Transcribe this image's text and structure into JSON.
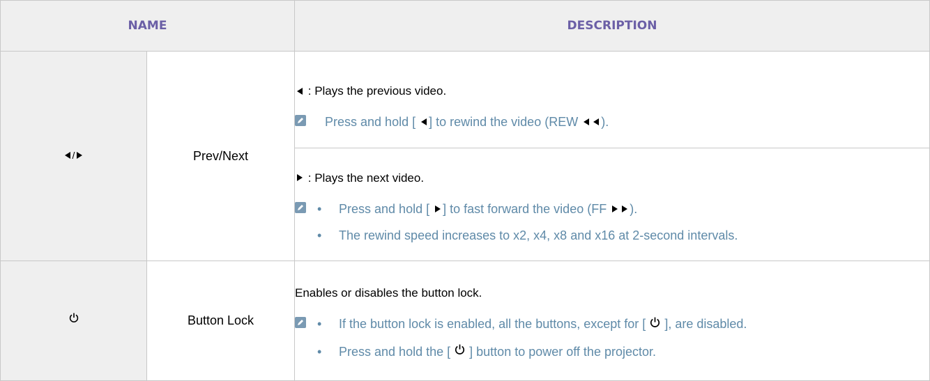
{
  "header": {
    "name": "NAME",
    "description": "DESCRIPTION"
  },
  "rows": {
    "prevnext": {
      "separator": "/",
      "name": "Prev/Next",
      "prev": {
        "lead": ": Plays the previous video.",
        "note_a": "Press and hold [",
        "note_b": "] to rewind the video (REW",
        "note_c": ")."
      },
      "next": {
        "lead": ": Plays the next video.",
        "bullet1_a": "Press and hold [",
        "bullet1_b": "] to fast forward the video (FF",
        "bullet1_c": ").",
        "bullet2": "The rewind speed increases to x2, x4, x8 and x16 at 2-second intervals."
      }
    },
    "lock": {
      "name": "Button Lock",
      "lead": "Enables or disables the button lock.",
      "bullet1_a": "If the button lock is enabled, all the buttons, except for [",
      "bullet1_b": "], are disabled.",
      "bullet2_a": "Press and hold the [",
      "bullet2_b": "] button to power off the projector."
    }
  },
  "icons": {
    "prev": "left-triangle-icon",
    "next": "right-triangle-icon",
    "power": "power-icon",
    "note": "note-icon"
  },
  "colors": {
    "header_text": "#6b5fa6",
    "note_text": "#5f8aa8",
    "shaded_cell": "#efefef",
    "border": "#c8c8c8"
  }
}
